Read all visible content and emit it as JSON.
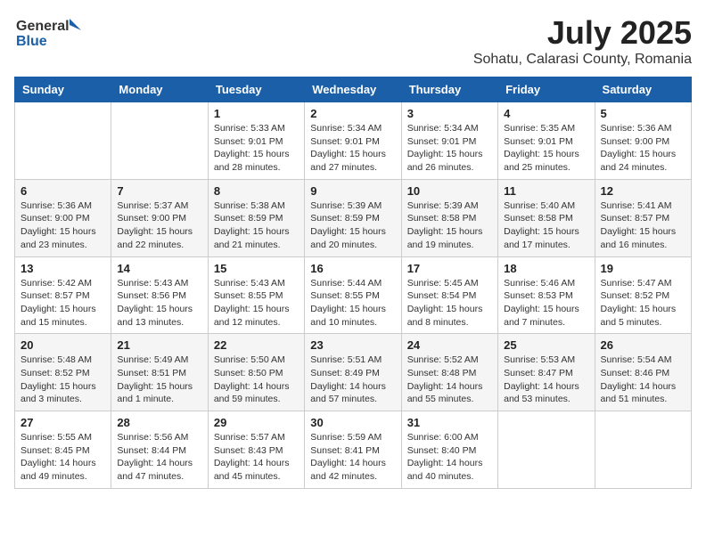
{
  "header": {
    "logo_general": "General",
    "logo_blue": "Blue",
    "month": "July 2025",
    "location": "Sohatu, Calarasi County, Romania"
  },
  "weekdays": [
    "Sunday",
    "Monday",
    "Tuesday",
    "Wednesday",
    "Thursday",
    "Friday",
    "Saturday"
  ],
  "weeks": [
    [
      {
        "day": null
      },
      {
        "day": null
      },
      {
        "day": "1",
        "sunrise": "5:33 AM",
        "sunset": "9:01 PM",
        "daylight": "15 hours and 28 minutes."
      },
      {
        "day": "2",
        "sunrise": "5:34 AM",
        "sunset": "9:01 PM",
        "daylight": "15 hours and 27 minutes."
      },
      {
        "day": "3",
        "sunrise": "5:34 AM",
        "sunset": "9:01 PM",
        "daylight": "15 hours and 26 minutes."
      },
      {
        "day": "4",
        "sunrise": "5:35 AM",
        "sunset": "9:01 PM",
        "daylight": "15 hours and 25 minutes."
      },
      {
        "day": "5",
        "sunrise": "5:36 AM",
        "sunset": "9:00 PM",
        "daylight": "15 hours and 24 minutes."
      }
    ],
    [
      {
        "day": "6",
        "sunrise": "5:36 AM",
        "sunset": "9:00 PM",
        "daylight": "15 hours and 23 minutes."
      },
      {
        "day": "7",
        "sunrise": "5:37 AM",
        "sunset": "9:00 PM",
        "daylight": "15 hours and 22 minutes."
      },
      {
        "day": "8",
        "sunrise": "5:38 AM",
        "sunset": "8:59 PM",
        "daylight": "15 hours and 21 minutes."
      },
      {
        "day": "9",
        "sunrise": "5:39 AM",
        "sunset": "8:59 PM",
        "daylight": "15 hours and 20 minutes."
      },
      {
        "day": "10",
        "sunrise": "5:39 AM",
        "sunset": "8:58 PM",
        "daylight": "15 hours and 19 minutes."
      },
      {
        "day": "11",
        "sunrise": "5:40 AM",
        "sunset": "8:58 PM",
        "daylight": "15 hours and 17 minutes."
      },
      {
        "day": "12",
        "sunrise": "5:41 AM",
        "sunset": "8:57 PM",
        "daylight": "15 hours and 16 minutes."
      }
    ],
    [
      {
        "day": "13",
        "sunrise": "5:42 AM",
        "sunset": "8:57 PM",
        "daylight": "15 hours and 15 minutes."
      },
      {
        "day": "14",
        "sunrise": "5:43 AM",
        "sunset": "8:56 PM",
        "daylight": "15 hours and 13 minutes."
      },
      {
        "day": "15",
        "sunrise": "5:43 AM",
        "sunset": "8:55 PM",
        "daylight": "15 hours and 12 minutes."
      },
      {
        "day": "16",
        "sunrise": "5:44 AM",
        "sunset": "8:55 PM",
        "daylight": "15 hours and 10 minutes."
      },
      {
        "day": "17",
        "sunrise": "5:45 AM",
        "sunset": "8:54 PM",
        "daylight": "15 hours and 8 minutes."
      },
      {
        "day": "18",
        "sunrise": "5:46 AM",
        "sunset": "8:53 PM",
        "daylight": "15 hours and 7 minutes."
      },
      {
        "day": "19",
        "sunrise": "5:47 AM",
        "sunset": "8:52 PM",
        "daylight": "15 hours and 5 minutes."
      }
    ],
    [
      {
        "day": "20",
        "sunrise": "5:48 AM",
        "sunset": "8:52 PM",
        "daylight": "15 hours and 3 minutes."
      },
      {
        "day": "21",
        "sunrise": "5:49 AM",
        "sunset": "8:51 PM",
        "daylight": "15 hours and 1 minute."
      },
      {
        "day": "22",
        "sunrise": "5:50 AM",
        "sunset": "8:50 PM",
        "daylight": "14 hours and 59 minutes."
      },
      {
        "day": "23",
        "sunrise": "5:51 AM",
        "sunset": "8:49 PM",
        "daylight": "14 hours and 57 minutes."
      },
      {
        "day": "24",
        "sunrise": "5:52 AM",
        "sunset": "8:48 PM",
        "daylight": "14 hours and 55 minutes."
      },
      {
        "day": "25",
        "sunrise": "5:53 AM",
        "sunset": "8:47 PM",
        "daylight": "14 hours and 53 minutes."
      },
      {
        "day": "26",
        "sunrise": "5:54 AM",
        "sunset": "8:46 PM",
        "daylight": "14 hours and 51 minutes."
      }
    ],
    [
      {
        "day": "27",
        "sunrise": "5:55 AM",
        "sunset": "8:45 PM",
        "daylight": "14 hours and 49 minutes."
      },
      {
        "day": "28",
        "sunrise": "5:56 AM",
        "sunset": "8:44 PM",
        "daylight": "14 hours and 47 minutes."
      },
      {
        "day": "29",
        "sunrise": "5:57 AM",
        "sunset": "8:43 PM",
        "daylight": "14 hours and 45 minutes."
      },
      {
        "day": "30",
        "sunrise": "5:59 AM",
        "sunset": "8:41 PM",
        "daylight": "14 hours and 42 minutes."
      },
      {
        "day": "31",
        "sunrise": "6:00 AM",
        "sunset": "8:40 PM",
        "daylight": "14 hours and 40 minutes."
      },
      {
        "day": null
      },
      {
        "day": null
      }
    ]
  ],
  "labels": {
    "sunrise": "Sunrise:",
    "sunset": "Sunset:",
    "daylight": "Daylight:"
  }
}
